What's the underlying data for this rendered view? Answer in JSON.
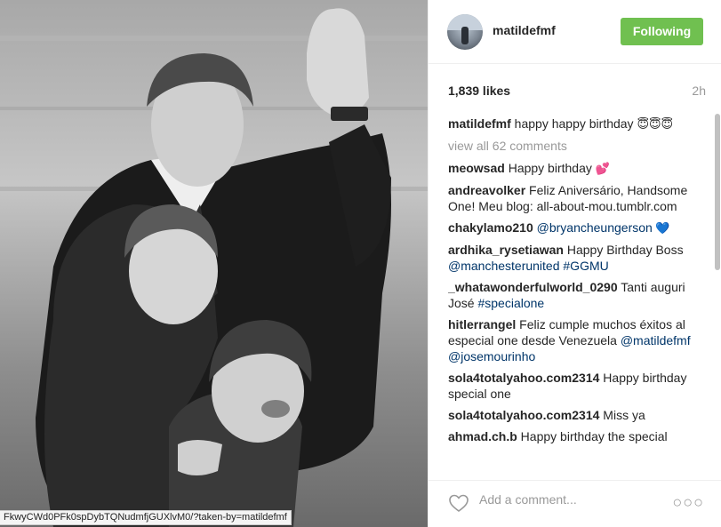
{
  "photo": {
    "status_url": "FkwyCWd0PFk0spDybTQNudmfjGUXlvM0/?taken-by=matildefmf"
  },
  "header": {
    "username": "matildefmf",
    "follow_label": "Following"
  },
  "stats": {
    "likes": "1,839 likes",
    "time": "2h"
  },
  "caption": {
    "user": "matildefmf",
    "text": " happy happy birthday ",
    "emoji": "😇😇😇"
  },
  "view_all": "view all 62 comments",
  "comments": [
    {
      "user": "meowsad",
      "text": " Happy birthday ",
      "extra": "💕"
    },
    {
      "user": "andreavolker",
      "text": " Feliz Aniversário, Handsome One! Meu blog: all-about-mou.tumblr.com"
    },
    {
      "user": "chakylamo210",
      "mention": " @bryancheungerson",
      "extra": " 💙"
    },
    {
      "user": "ardhika_rysetiawan",
      "text": " Happy Birthday Boss ",
      "mention": "@manchesterunited #GGMU"
    },
    {
      "user": "_whatawonderfulworld_0290",
      "text": " Tanti auguri José ",
      "mention": "#specialone"
    },
    {
      "user": "hitlerrangel",
      "text": " Feliz cumple muchos éxitos al especial one desde Venezuela ",
      "mention": "@matildefmf @josemourinho"
    },
    {
      "user": "sola4totalyahoo.com2314",
      "text": " Happy birthday special one"
    },
    {
      "user": "sola4totalyahoo.com2314",
      "text": " Miss ya"
    },
    {
      "user": "ahmad.ch.b",
      "text": " Happy birthday the special"
    }
  ],
  "footer": {
    "placeholder": "Add a comment...",
    "more": "○○○"
  },
  "icons": {
    "heart": "heart-icon",
    "more": "more-options-icon"
  },
  "colors": {
    "follow_button": "#70c050",
    "mention": "#003569",
    "muted": "#999999"
  }
}
